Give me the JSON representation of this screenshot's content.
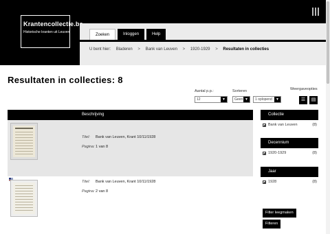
{
  "site": {
    "logo_name": "Krantencollectie.be",
    "logo_tagline": "Historische kranten uit Leuven"
  },
  "nav": {
    "tabs": [
      {
        "label": "Zoeken",
        "active": true
      },
      {
        "label": "Inloggen",
        "active": false
      },
      {
        "label": "Help",
        "active": false
      }
    ]
  },
  "breadcrumb": {
    "prefix": "U bent hier:",
    "items": [
      "Bladeren",
      "Bank van Leuven",
      "1920-1929"
    ],
    "current": "Resultaten in collecties",
    "separator": ">"
  },
  "page": {
    "title": "Resultaten in collecties: 8"
  },
  "controls": {
    "per_page_label": "Aantal p.p.:",
    "per_page_value": "12",
    "sort_label": "Sorteren",
    "sort_field_value": "Geen",
    "sort_order_value": "1 oplopend",
    "view_label": "Weergaveopties"
  },
  "results": {
    "column_header": "Beschrijving",
    "title_key": "Titel:",
    "page_key": "Pagina:",
    "items": [
      {
        "title": "Bank van Leuven, Krant 10/11/1928",
        "page": "1 van 8"
      },
      {
        "title": "Bank van Leuven, Krant 10/11/1928",
        "page": "2 van 8"
      }
    ]
  },
  "facets": [
    {
      "title": "Collectie",
      "items": [
        {
          "label": "Bank van Leuven",
          "count": "(8)"
        }
      ]
    },
    {
      "title": "Decennium",
      "items": [
        {
          "label": "1920-1929",
          "count": "(8)"
        }
      ]
    },
    {
      "title": "Jaar",
      "items": [
        {
          "label": "1928",
          "count": "(8)"
        }
      ]
    }
  ],
  "actions": {
    "clear_filters": "Filter leegmaken",
    "apply_filters": "Filteren"
  },
  "icons": {
    "menu": "hamburger-icon",
    "list_view": "list-icon",
    "grid_view": "grid-icon",
    "flag": "flag-icon"
  }
}
